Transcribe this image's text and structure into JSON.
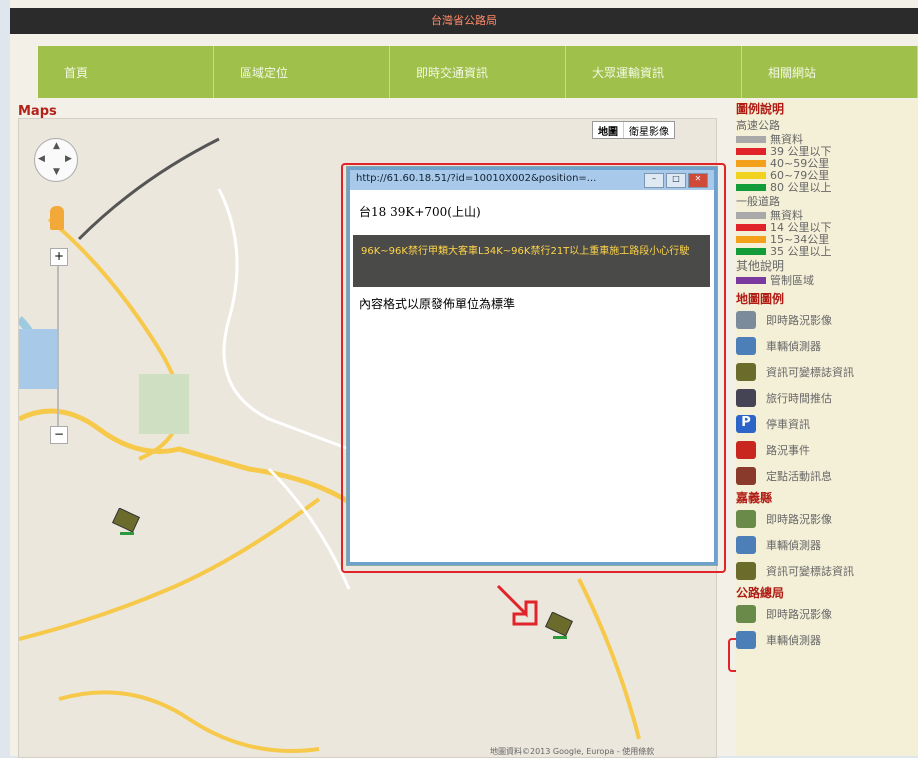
{
  "header": {
    "site_title": "台灣省公路局"
  },
  "nav": {
    "items": [
      "首頁",
      "區域定位",
      "即時交通資訊",
      "大眾運輸資訊",
      "相關網站"
    ]
  },
  "maps_label": "Maps",
  "map_type": {
    "map": "地圖",
    "satellite": "衛星影像"
  },
  "popup": {
    "url": "http://61.60.18.51/?id=10010X002&position=...",
    "location": "台18 39K+700(上山)",
    "notice": "96K~96K禁行甲類大客車L34K~96K禁行21T以上重車施工路段小心行駛",
    "note": "內容格式以原發佈單位為標準"
  },
  "legend": {
    "title": "圖例說明",
    "highway_title": "高速公路",
    "highway": [
      {
        "label": "無資料",
        "color": "#a9a9a9"
      },
      {
        "label": "39 公里以下",
        "color": "#e0242a"
      },
      {
        "label": "40~59公里",
        "color": "#f3a11b"
      },
      {
        "label": "60~79公里",
        "color": "#f1d21f"
      },
      {
        "label": "80 公里以上",
        "color": "#139c3a"
      }
    ],
    "general_title": "一般道路",
    "general": [
      {
        "label": "無資料",
        "color": "#a9a9a9"
      },
      {
        "label": "14 公里以下",
        "color": "#e0242a"
      },
      {
        "label": "15~34公里",
        "color": "#f3a11b"
      },
      {
        "label": "35 公里以上",
        "color": "#139c3a"
      }
    ],
    "other_title": "其他說明",
    "other": [
      {
        "label": "管制區域",
        "color": "#7b3aa0"
      }
    ]
  },
  "map_legend": {
    "title": "地圖圖例",
    "items": [
      "即時路況影像",
      "車輛偵測器",
      "資訊可變標誌資訊",
      "旅行時間推估",
      "停車資訊",
      "路況事件",
      "定點活動訊息"
    ]
  },
  "chiayi": {
    "title": "嘉義縣",
    "items": [
      "即時路況影像",
      "車輛偵測器",
      "資訊可變標誌資訊"
    ]
  },
  "highway_bureau": {
    "title": "公路總局",
    "items": [
      "即時路況影像",
      "車輛偵測器"
    ]
  },
  "map_footer": "地圖資料©2013 Google, Europa - 使用條款"
}
